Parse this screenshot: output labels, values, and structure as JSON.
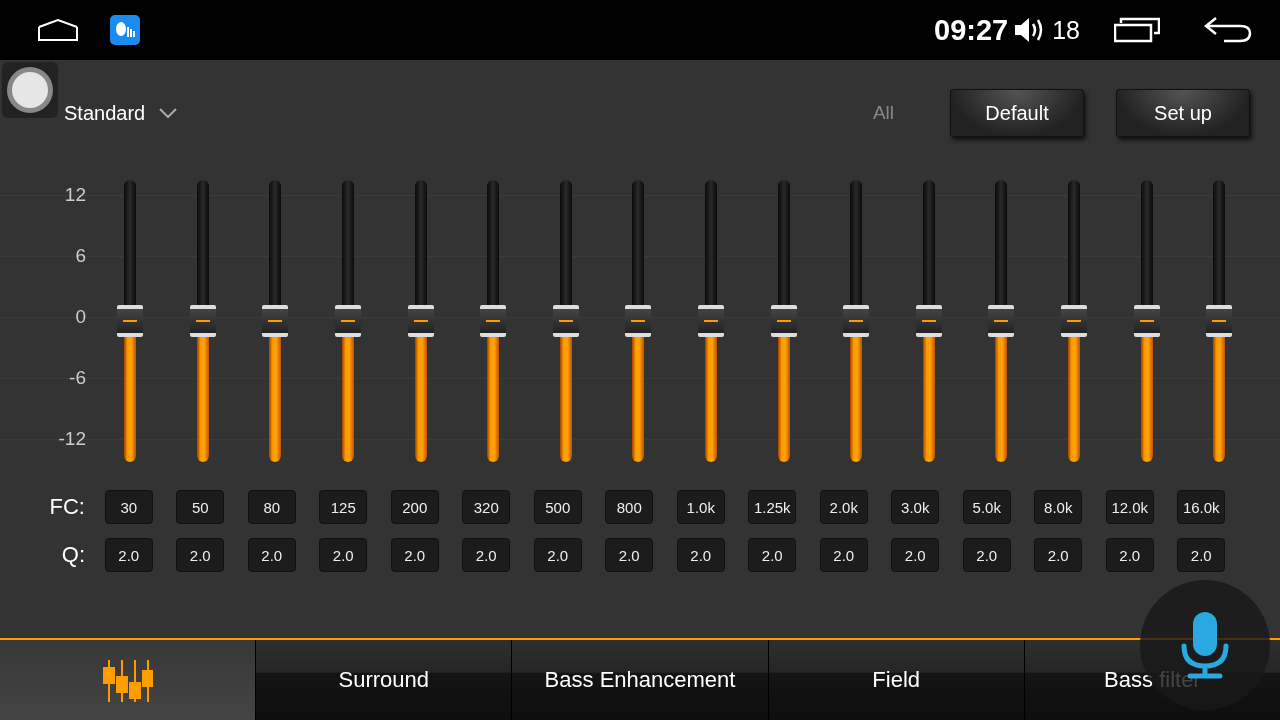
{
  "status_bar": {
    "time": "09:27",
    "volume": "18"
  },
  "preset": {
    "label": "Standard"
  },
  "mode_label": "All",
  "buttons": [
    {
      "label": "Default"
    },
    {
      "label": "Set up"
    }
  ],
  "scale": [
    "12",
    "6",
    "0",
    "-6",
    "-12"
  ],
  "row_labels": {
    "fc": "FC:",
    "q": "Q:"
  },
  "bands": [
    {
      "fc": "30",
      "q": "2.0",
      "level": 0.5
    },
    {
      "fc": "50",
      "q": "2.0",
      "level": 0.5
    },
    {
      "fc": "80",
      "q": "2.0",
      "level": 0.5
    },
    {
      "fc": "125",
      "q": "2.0",
      "level": 0.5
    },
    {
      "fc": "200",
      "q": "2.0",
      "level": 0.5
    },
    {
      "fc": "320",
      "q": "2.0",
      "level": 0.5
    },
    {
      "fc": "500",
      "q": "2.0",
      "level": 0.5
    },
    {
      "fc": "800",
      "q": "2.0",
      "level": 0.5
    },
    {
      "fc": "1.0k",
      "q": "2.0",
      "level": 0.5
    },
    {
      "fc": "1.25k",
      "q": "2.0",
      "level": 0.5
    },
    {
      "fc": "2.0k",
      "q": "2.0",
      "level": 0.5
    },
    {
      "fc": "3.0k",
      "q": "2.0",
      "level": 0.5
    },
    {
      "fc": "5.0k",
      "q": "2.0",
      "level": 0.5
    },
    {
      "fc": "8.0k",
      "q": "2.0",
      "level": 0.5
    },
    {
      "fc": "12.0k",
      "q": "2.0",
      "level": 0.5
    },
    {
      "fc": "16.0k",
      "q": "2.0",
      "level": 0.5
    }
  ],
  "tabs": [
    {
      "kind": "icon",
      "selected": true
    },
    {
      "kind": "text",
      "label": "Surround",
      "selected": false
    },
    {
      "kind": "text",
      "label": "Bass Enhancement",
      "selected": false
    },
    {
      "kind": "text",
      "label": "Field",
      "selected": false
    },
    {
      "kind": "text",
      "label": "Bass filter",
      "selected": false
    }
  ]
}
